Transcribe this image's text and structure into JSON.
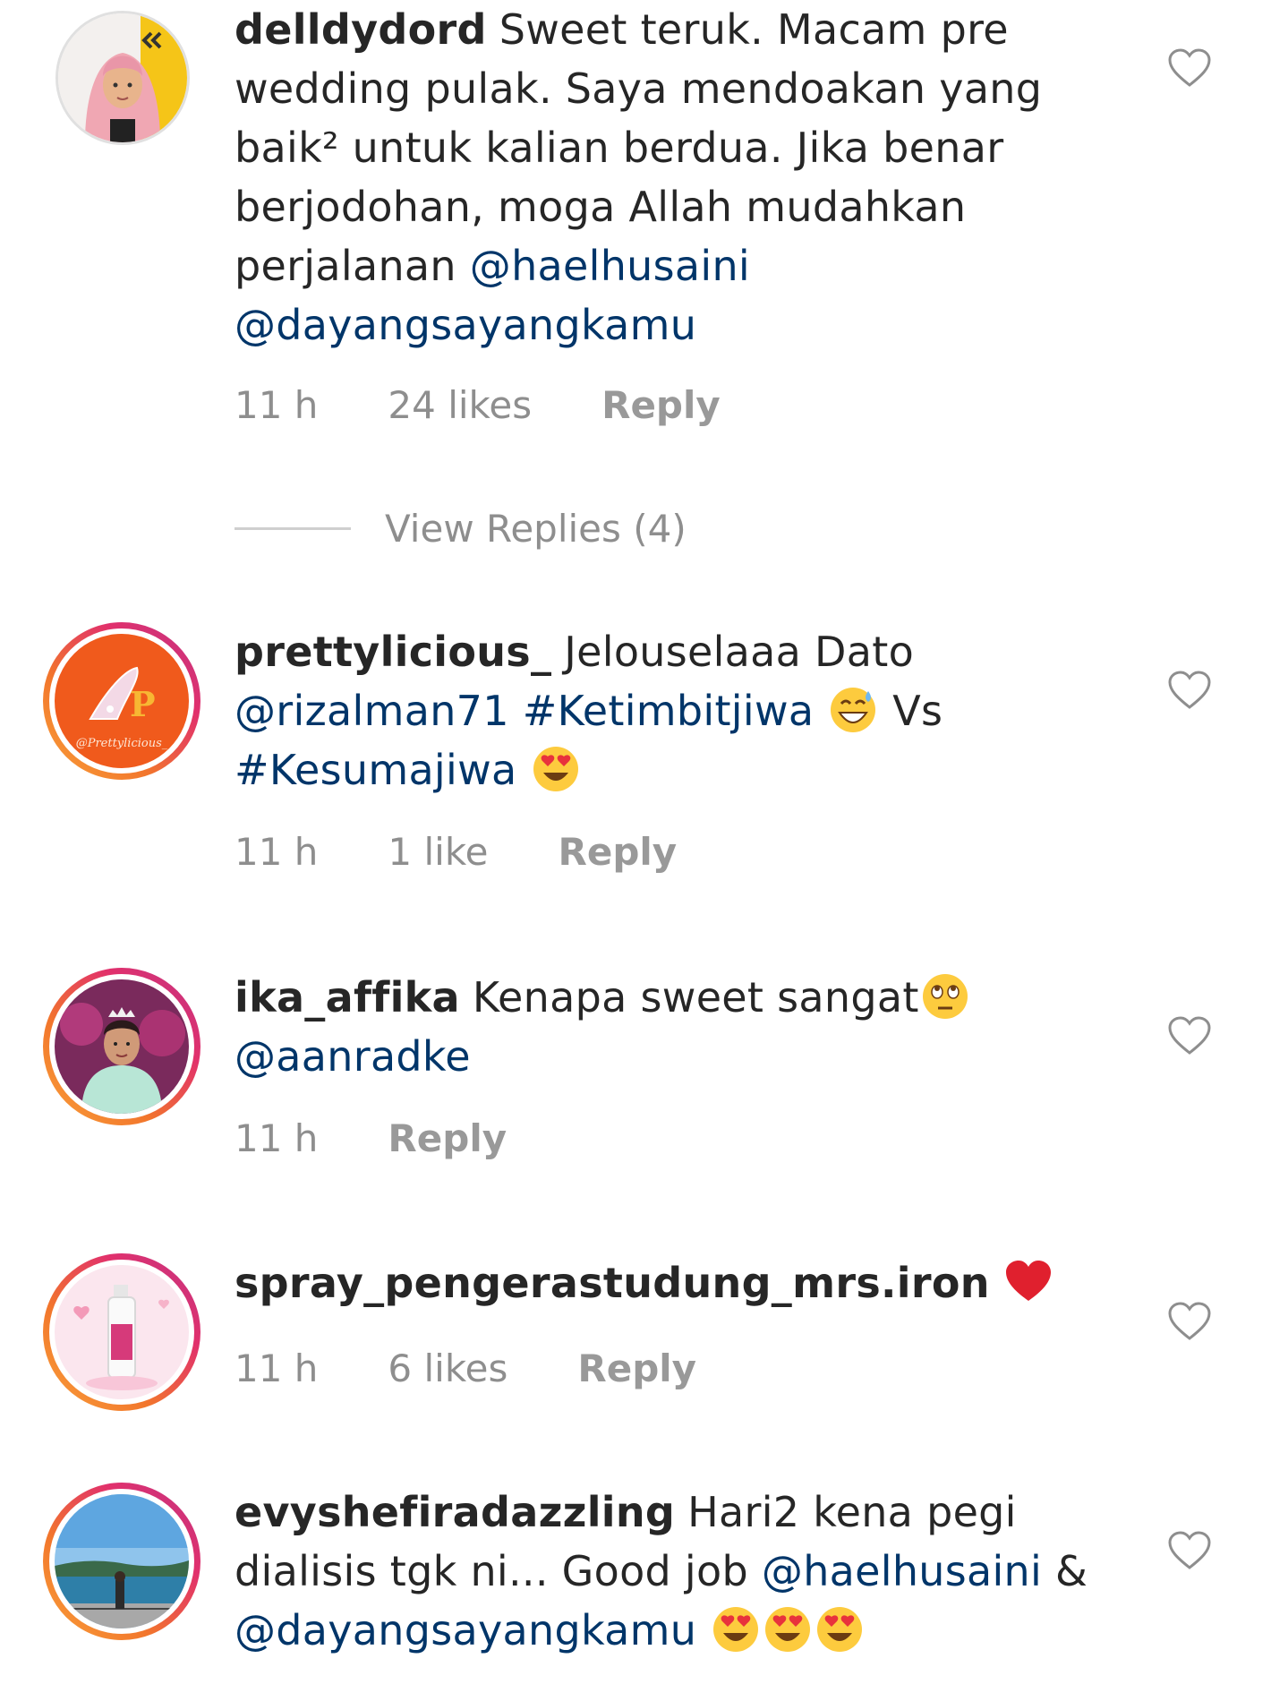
{
  "comments": [
    {
      "username": "delldydord",
      "text_pre": "Sweet teruk.  Macam pre wedding pulak. Saya mendoakan yang baik² untuk kalian berdua. Jika benar berjodohan, moga Allah mudahkan perjalanan ",
      "mention1": "@haelhusaini",
      "mention2": "@dayangsayangkamu",
      "time": "11 h",
      "likes": "24 likes",
      "reply": "Reply"
    },
    {
      "username": "prettylicious_",
      "text_pre": "Jelouselaaa Dato ",
      "mention1": "@rizalman71",
      "hashtag1": "#Ketimbitjiwa",
      "text_mid": " Vs ",
      "hashtag2": "#Kesumajiwa",
      "avatar_label": "@Prettylicious_",
      "time": "11 h",
      "likes": "1 like",
      "reply": "Reply"
    },
    {
      "username": "ika_affika",
      "text_pre": "Kenapa sweet sangat",
      "mention1": "@aanradke",
      "time": "11 h",
      "reply": "Reply"
    },
    {
      "username": "spray_pengerastudung_mrs.iron",
      "time": "11 h",
      "likes": "6 likes",
      "reply": "Reply"
    },
    {
      "username": "evyshefiradazzling",
      "text_pre": "Hari2 kena pegi dialisis tgk ni... Good job ",
      "mention1": "@haelhusaini",
      "text_mid": " & ",
      "mention2": "@dayangsayangkamu"
    }
  ],
  "view_replies": "View Replies (4)",
  "icons": {
    "like": "heart-outline-icon",
    "emoji_sweat": "grinning-sweat-emoji",
    "emoji_heart_eyes": "heart-eyes-emoji",
    "emoji_roll_eyes": "face-with-rolling-eyes-emoji",
    "emoji_red_heart": "red-heart-emoji"
  },
  "colors": {
    "mention": "#003569",
    "meta": "#8e8e8e",
    "story_ring_start": "#f9a13a",
    "story_ring_end": "#c13584"
  }
}
